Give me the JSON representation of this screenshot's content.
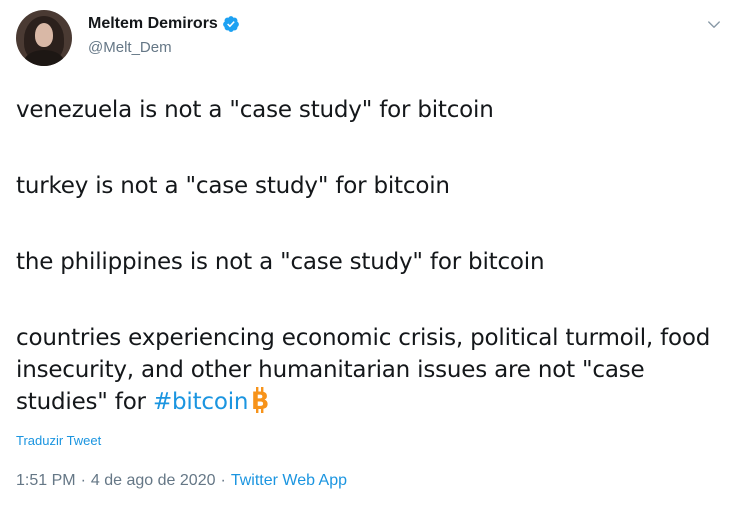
{
  "author": {
    "display_name": "Meltem Demirors",
    "handle": "@Melt_Dem",
    "verified": true
  },
  "tweet": {
    "paragraphs": [
      "venezuela is not a \"case study\" for bitcoin",
      "turkey is not a \"case study\" for bitcoin",
      "the philippines is not a \"case study\" for bitcoin"
    ],
    "last_paragraph_text": "countries experiencing economic crisis, political turmoil, food insecurity, and other humanitarian issues are not \"case studies\" for ",
    "hashtag": "#bitcoin",
    "emoji_icon": "bitcoin-icon"
  },
  "translate_label": "Traduzir Tweet",
  "meta": {
    "time": "1:51 PM",
    "separator": "·",
    "date": "4 de ago de 2020",
    "source": "Twitter Web App"
  },
  "colors": {
    "link": "#1b95e0",
    "secondary_text": "#657786",
    "verified_badge": "#1da1f2",
    "bitcoin": "#f7931a"
  }
}
